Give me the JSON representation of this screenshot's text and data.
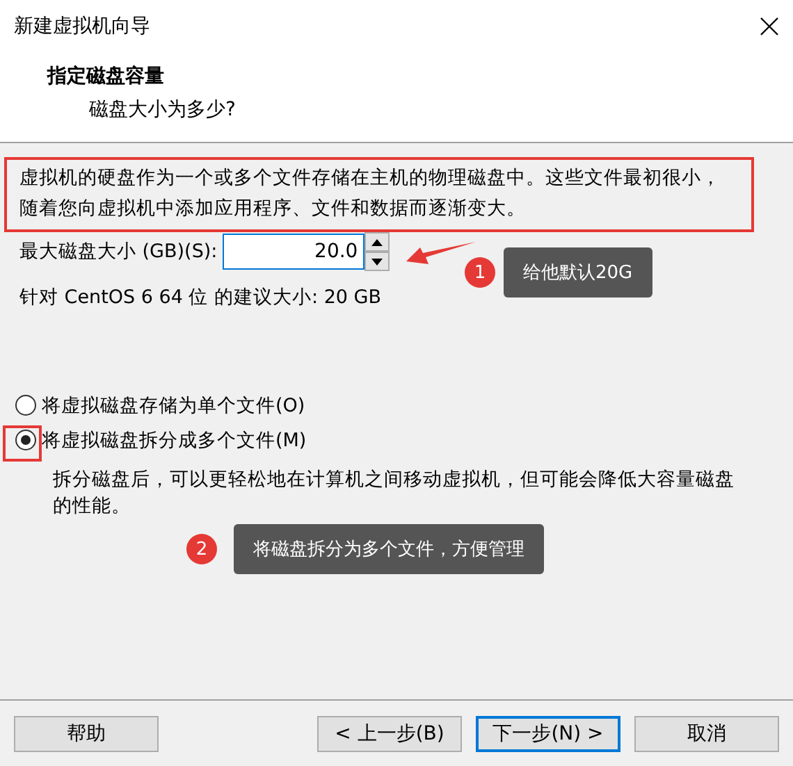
{
  "window": {
    "title": "新建虚拟机向导"
  },
  "header": {
    "title": "指定磁盘容量",
    "subtitle": "磁盘大小为多少?"
  },
  "intro": [
    "虚拟机的硬盘作为一个或多个文件存储在主机的物理磁盘中。这些文件最初很小，",
    "随着您向虚拟机中添加应用程序、文件和数据而逐渐变大。"
  ],
  "disk_size": {
    "label": "最大磁盘大小 (GB)(S):",
    "value": "20.0"
  },
  "recommendation": "针对 CentOS 6 64 位 的建议大小: 20 GB",
  "options": [
    {
      "label": "将虚拟磁盘存储为单个文件(O)",
      "selected": false
    },
    {
      "label": "将虚拟磁盘拆分成多个文件(M)",
      "selected": true
    }
  ],
  "split_note": "拆分磁盘后，可以更轻松地在计算机之间移动虚拟机，但可能会降低大容量磁盘的性能。",
  "buttons": [
    {
      "label": "帮助",
      "default": false
    },
    {
      "label": "< 上一步(B)",
      "default": false
    },
    {
      "label": "下一步(N) >",
      "default": true
    },
    {
      "label": "取消",
      "default": false
    }
  ],
  "annotations": [
    {
      "number": "1",
      "text": "给他默认20G"
    },
    {
      "number": "2",
      "text": "将磁盘拆分为多个文件，方便管理"
    }
  ]
}
